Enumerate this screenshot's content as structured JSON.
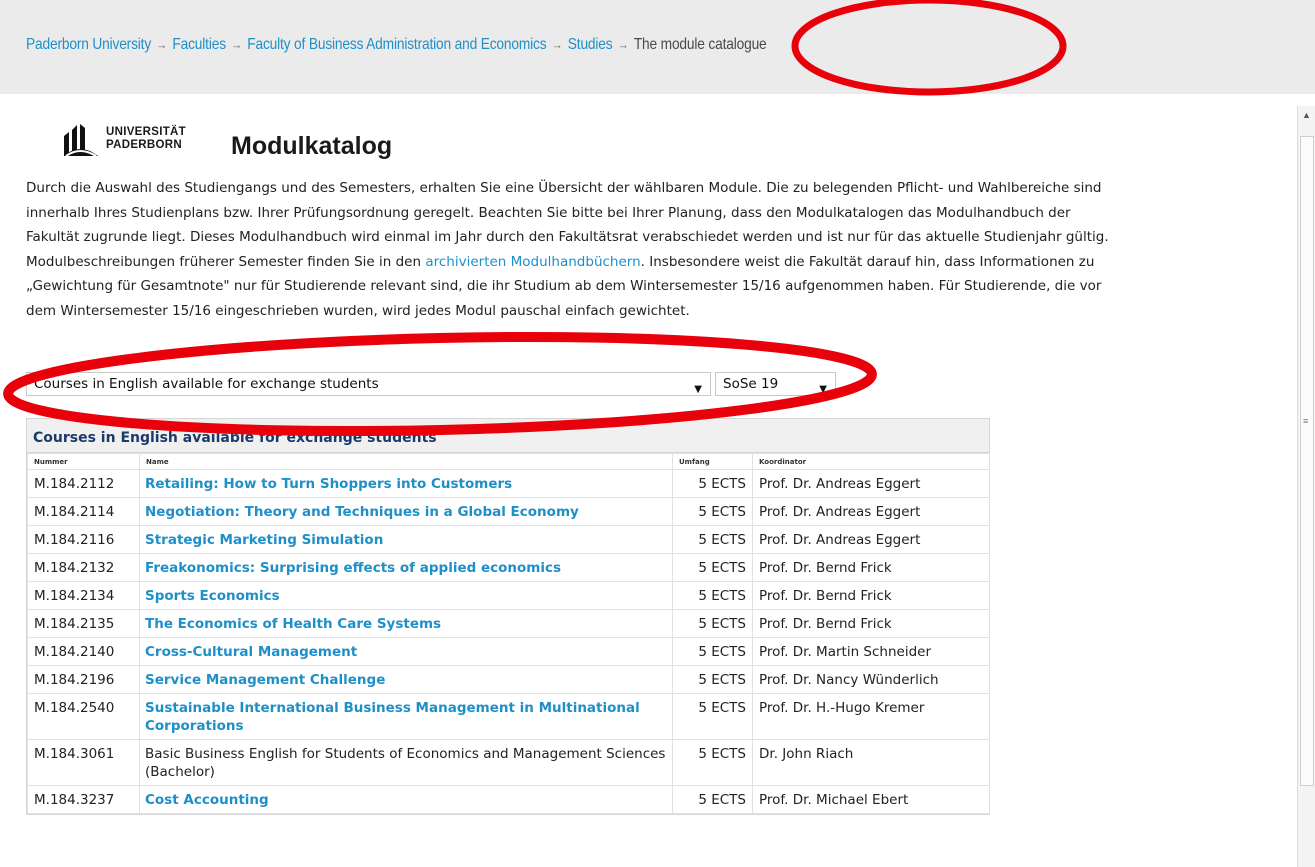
{
  "breadcrumb": {
    "items": [
      "Paderborn University",
      "Faculties",
      "Faculty of Business Administration and Economics",
      "Studies"
    ],
    "separator": "→",
    "current": "The module catalogue"
  },
  "header": {
    "logo_line1": "UNIVERSITÄT",
    "logo_line2": "PADERBORN",
    "title": "Modulkatalog"
  },
  "intro": {
    "part1": "Durch die Auswahl des Studiengangs und des Semesters, erhalten Sie eine Übersicht der wählbaren Module. Die zu belegenden Pflicht- und Wahlbereiche sind innerhalb Ihres Studienplans bzw. Ihrer Prüfungsordnung geregelt. Beachten Sie bitte bei Ihrer Planung, dass den Modulkatalogen das Modulhandbuch der Fakultät zugrunde liegt. Dieses Modulhandbuch wird einmal im Jahr durch den Fakultätsrat verabschiedet werden und ist nur für das aktuelle Studienjahr gültig. Modulbeschreibungen früherer Semester finden Sie in den",
    "link": "archivierten Modulhandbüchern",
    "part2": ". Insbesondere weist die Fakultät darauf hin, dass Informationen zu „Gewichtung für Gesamtnote\" nur für Studierende relevant sind, die ihr Studium ab dem Wintersemester 15/16 aufgenommen haben. Für Studierende, die vor dem Wintersemester 15/16 eingeschrieben wurden, wird jedes Modul pauschal einfach gewichtet."
  },
  "filters": {
    "program_selected": "Courses in English available for exchange students",
    "semester_selected": "SoSe 19",
    "arrow": "▼"
  },
  "table": {
    "caption": "Courses in English available for exchange students",
    "headers": [
      "Nummer",
      "Name",
      "Umfang",
      "Koordinator"
    ],
    "rows": [
      {
        "num": "M.184.2112",
        "name": "Retailing: How to Turn Shoppers into Customers",
        "link": true,
        "ects": "5 ECTS",
        "coord": "Prof. Dr. Andreas Eggert"
      },
      {
        "num": "M.184.2114",
        "name": "Negotiation: Theory and Techniques in a Global Economy",
        "link": true,
        "ects": "5 ECTS",
        "coord": "Prof. Dr. Andreas Eggert"
      },
      {
        "num": "M.184.2116",
        "name": "Strategic Marketing Simulation",
        "link": true,
        "ects": "5 ECTS",
        "coord": "Prof. Dr. Andreas Eggert"
      },
      {
        "num": "M.184.2132",
        "name": "Freakonomics: Surprising effects of applied economics",
        "link": true,
        "ects": "5 ECTS",
        "coord": "Prof. Dr. Bernd Frick"
      },
      {
        "num": "M.184.2134",
        "name": "Sports Economics",
        "link": true,
        "ects": "5 ECTS",
        "coord": "Prof. Dr. Bernd Frick"
      },
      {
        "num": "M.184.2135",
        "name": "The Economics of Health Care Systems",
        "link": true,
        "ects": "5 ECTS",
        "coord": "Prof. Dr. Bernd Frick"
      },
      {
        "num": "M.184.2140",
        "name": "Cross-Cultural Management",
        "link": true,
        "ects": "5 ECTS",
        "coord": "Prof. Dr. Martin Schneider"
      },
      {
        "num": "M.184.2196",
        "name": "Service Management Challenge",
        "link": true,
        "ects": "5 ECTS",
        "coord": "Prof. Dr. Nancy Wünderlich"
      },
      {
        "num": "M.184.2540",
        "name": "Sustainable International Business Management in Multinational Corporations",
        "link": true,
        "ects": "5 ECTS",
        "coord": "Prof. Dr. H.-Hugo Kremer"
      },
      {
        "num": "M.184.3061",
        "name": "Basic Business English for Students of Economics and Management Sciences (Bachelor)",
        "link": false,
        "ects": "5 ECTS",
        "coord": "Dr. John Riach"
      },
      {
        "num": "M.184.3237",
        "name": "Cost Accounting",
        "link": true,
        "ects": "5 ECTS",
        "coord": "Prof. Dr. Michael Ebert"
      }
    ]
  },
  "colors": {
    "link": "#1f8fc8",
    "annotation": "#e8000b",
    "breadcrumb_bg": "#ebebeb"
  },
  "icons": {
    "scroll_up": "scroll-up-arrow-icon",
    "scroll_grip": "scroll-grip-icon",
    "logo": "university-logo-icon"
  }
}
